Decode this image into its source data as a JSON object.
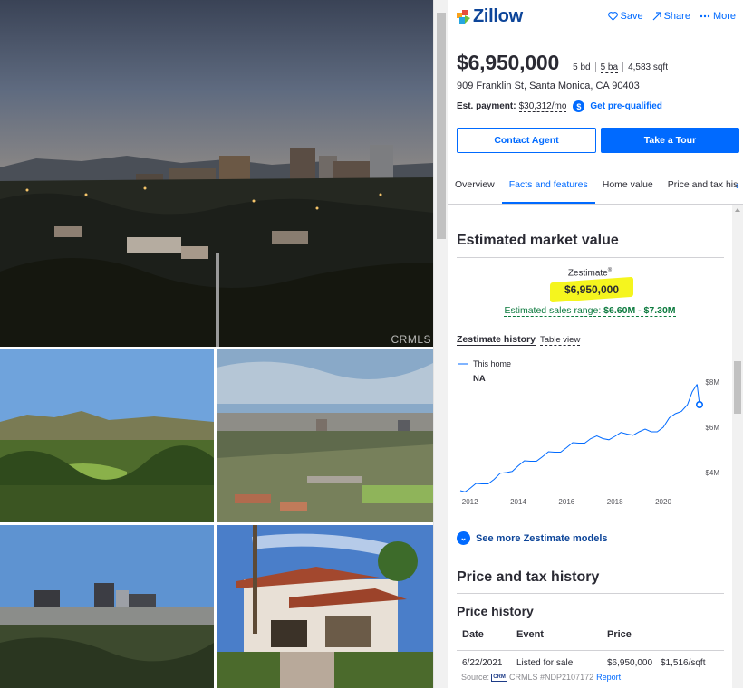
{
  "gallery": {
    "watermark": "CRMLS",
    "photos": [
      "city-skyline-dusk",
      "golf-course-hills",
      "aerial-neighborhood",
      "downtown-skyline",
      "house-exterior-palms"
    ]
  },
  "header": {
    "brand": "Zillow",
    "actions": [
      {
        "label": "Save",
        "icon": "heart-icon"
      },
      {
        "label": "Share",
        "icon": "share-icon"
      },
      {
        "label": "More",
        "icon": "more-dots-icon"
      }
    ]
  },
  "listing": {
    "price": "$6,950,000",
    "beds": "5 bd",
    "baths": "5 ba",
    "sqft": "4,583 sqft",
    "address": "909 Franklin St, Santa Monica, CA 90403",
    "est_payment_label": "Est. payment:",
    "est_payment_value": "$30,312/mo",
    "prequal": "Get pre-qualified"
  },
  "buttons": {
    "contact": "Contact Agent",
    "tour": "Take a Tour"
  },
  "tabs": [
    "Overview",
    "Facts and features",
    "Home value",
    "Price and tax his"
  ],
  "market": {
    "title": "Estimated market value",
    "zestimate_label": "Zestimate",
    "zestimate_sup": "®",
    "zestimate_value": "$6,950,000",
    "range_label": "Estimated sales range:",
    "range_value": "$6.60M - $7.30M",
    "history_title": "Zestimate history",
    "table_view": "Table view",
    "more_models": "See more Zestimate models"
  },
  "chart_data": {
    "type": "line",
    "series": [
      {
        "name": "This home",
        "subtitle": "NA",
        "color": "#006aff",
        "x": [
          2011.6,
          2012.0,
          2012.5,
          2013.0,
          2013.5,
          2014.0,
          2014.5,
          2015.0,
          2015.5,
          2016.0,
          2016.5,
          2017.0,
          2017.5,
          2018.0,
          2018.5,
          2019.0,
          2019.5,
          2020.0,
          2020.5,
          2021.0,
          2021.4
        ],
        "y": [
          3.2,
          3.3,
          3.5,
          3.7,
          4.0,
          4.3,
          4.5,
          4.7,
          4.9,
          5.1,
          5.3,
          5.5,
          5.5,
          5.6,
          5.7,
          5.8,
          5.8,
          6.0,
          6.6,
          7.0,
          7.9
        ]
      }
    ],
    "end_point": {
      "x": 2021.5,
      "y": 7.0
    },
    "x_ticks": [
      "2012",
      "2014",
      "2016",
      "2018",
      "2020"
    ],
    "x_tick_values": [
      2012,
      2014,
      2016,
      2018,
      2020
    ],
    "y_ticks": [
      "$4M",
      "$6M",
      "$8M"
    ],
    "y_tick_values": [
      4,
      6,
      8
    ],
    "xlim": [
      2011.6,
      2022.4
    ],
    "ylim": [
      3.2,
      8.6
    ],
    "xlabel": "",
    "ylabel": ""
  },
  "price_tax": {
    "title": "Price and tax history",
    "price_history_title": "Price history",
    "columns": [
      "Date",
      "Event",
      "Price"
    ],
    "rows": [
      {
        "date": "6/22/2021",
        "event": "Listed for sale",
        "price": "$6,950,000",
        "psf": "$1,516/sqft"
      }
    ],
    "source_label": "Source:",
    "source_logo": "CRM",
    "source_text": "CRMLS #NDP2107172",
    "report": "Report"
  }
}
